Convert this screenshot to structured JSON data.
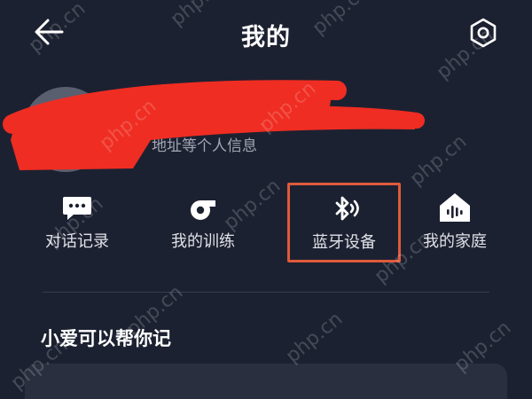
{
  "header": {
    "title": "我的",
    "back_icon": "arrow-left-icon",
    "settings_icon": "gear-icon"
  },
  "profile": {
    "hint": "昵称、地址等个人信息"
  },
  "shortcuts": [
    {
      "label": "对话记录",
      "icon": "chat-bubble-icon"
    },
    {
      "label": "我的训练",
      "icon": "whistle-icon"
    },
    {
      "label": "蓝牙设备",
      "icon": "bluetooth-icon",
      "highlighted": true
    },
    {
      "label": "我的家庭",
      "icon": "home-voice-icon"
    }
  ],
  "section": {
    "title": "小爱可以帮你记"
  },
  "colors": {
    "background": "#1c2131",
    "highlight_border": "#e05a3a",
    "redaction": "#ef2d22"
  },
  "watermark_text": "php.cn"
}
